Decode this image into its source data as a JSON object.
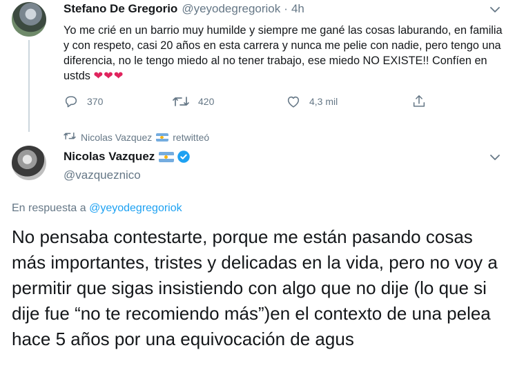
{
  "tweet1": {
    "author_name": "Stefano De Gregorio",
    "author_handle": "@yeyodegregoriok",
    "separator": "·",
    "time": "4h",
    "text": "Yo me crié en un barrio muy humilde y siempre me gané las cosas laburando, en familia y con respeto, casi 20 años en esta carrera y nunca me pelie con nadie, pero tengo una diferencia, no le tengo miedo al no tener trabajo, ese miedo NO EXISTE!! Confíen en ustds",
    "emoji": "❤❤❤",
    "actions": {
      "reply_count": "370",
      "retweet_count": "420",
      "like_count": "4,3 mil"
    }
  },
  "retweet_context": {
    "text": "Nicolas Vazquez",
    "suffix": "retwitteó"
  },
  "tweet2": {
    "author_name": "Nicolas Vazquez",
    "author_handle": "@vazqueznico",
    "reply_prefix": "En respuesta a",
    "reply_handle": "@yeyodegregoriok",
    "text": "No pensaba contestarte, porque me están pasando cosas más importantes, tristes y delicadas en la vida, pero no voy a permitir que sigas insistiendo con algo que no dije (lo que si dije fue “no te recomiendo más”)en el contexto de una pelea hace 5 años por una equivocación de agus"
  },
  "colors": {
    "text": "#14171a",
    "secondary": "#657786",
    "accent": "#1da1f2",
    "heart": "#e0245e"
  },
  "icons": [
    "chevron-down-icon",
    "reply-icon",
    "retweet-icon",
    "like-icon",
    "share-icon",
    "argentina-flag-icon",
    "verified-badge-icon"
  ]
}
